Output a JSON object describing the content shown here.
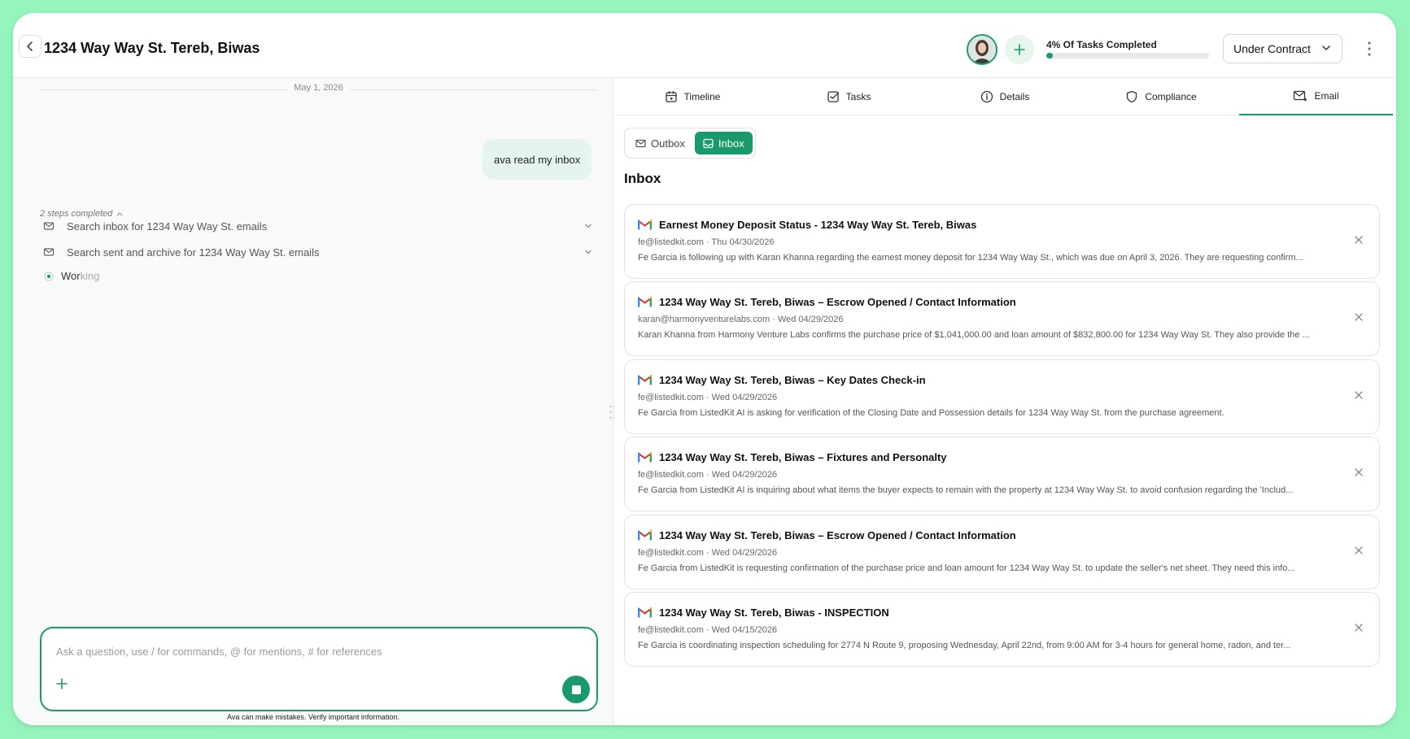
{
  "header": {
    "title": "1234 Way Way St. Tereb, Biwas",
    "progress_label": "4% Of Tasks Completed",
    "progress_fraction": 0.04,
    "status": "Under Contract"
  },
  "chat": {
    "date_separator": "May 1, 2026",
    "user_message": "ava read my inbox",
    "steps_summary": "2 steps completed",
    "steps": [
      {
        "label": "Search inbox for 1234 Way Way St. emails",
        "icon": "mail-icon"
      },
      {
        "label": "Search sent and archive for 1234 Way Way St. emails",
        "icon": "mail-icon"
      }
    ],
    "working_part1": "Wor",
    "working_part2": "king",
    "composer_placeholder": "Ask a question, use / for commands, @ for mentions, # for references",
    "disclaimer": "Ava can make mistakes. Verify important information."
  },
  "tabs": [
    {
      "label": "Timeline",
      "icon": "calendar-icon"
    },
    {
      "label": "Tasks",
      "icon": "checkbox-icon"
    },
    {
      "label": "Details",
      "icon": "info-icon"
    },
    {
      "label": "Compliance",
      "icon": "shield-icon"
    },
    {
      "label": "Email",
      "icon": "mail-icon",
      "active": true
    }
  ],
  "mailbox": {
    "outbox_label": "Outbox",
    "inbox_label": "Inbox",
    "heading": "Inbox"
  },
  "emails": [
    {
      "subject": "Earnest Money Deposit Status - 1234 Way Way St. Tereb, Biwas",
      "meta": "fe@listedkit.com · Thu 04/30/2026",
      "preview": "Fe Garcia is following up with Karan Khanna regarding the earnest money deposit for 1234 Way Way St., which was due on April 3, 2026. They are requesting confirm..."
    },
    {
      "subject": "1234 Way Way St. Tereb, Biwas – Escrow Opened / Contact Information",
      "meta": "karan@harmonyventurelabs.com · Wed 04/29/2026",
      "preview": "Karan Khanna from Harmony Venture Labs confirms the purchase price of $1,041,000.00 and loan amount of $832,800.00 for 1234 Way Way St. They also provide the ..."
    },
    {
      "subject": "1234 Way Way St. Tereb, Biwas – Key Dates Check-in",
      "meta": "fe@listedkit.com · Wed 04/29/2026",
      "preview": "Fe Garcia from ListedKit AI is asking for verification of the Closing Date and Possession details for 1234 Way Way St. from the purchase agreement."
    },
    {
      "subject": "1234 Way Way St. Tereb, Biwas – Fixtures and Personalty",
      "meta": "fe@listedkit.com · Wed 04/29/2026",
      "preview": "Fe Garcia from ListedKit AI is inquiring about what items the buyer expects to remain with the property at 1234 Way Way St. to avoid confusion regarding the 'Includ..."
    },
    {
      "subject": "1234 Way Way St. Tereb, Biwas – Escrow Opened / Contact Information",
      "meta": "fe@listedkit.com · Wed 04/29/2026",
      "preview": "Fe Garcia from ListedKit is requesting confirmation of the purchase price and loan amount for 1234 Way Way St. to update the seller's net sheet. They need this info..."
    },
    {
      "subject": "1234 Way Way St. Tereb, Biwas - INSPECTION",
      "meta": "fe@listedkit.com · Wed 04/15/2026",
      "preview": "Fe Garcia is coordinating inspection scheduling for 2774 N Route 9, proposing Wednesday, April 22nd, from 9:00 AM for 3-4 hours for general home, radon, and ter..."
    }
  ],
  "colors": {
    "accent": "#1a9a6b",
    "page_background": "#95f5bd",
    "bubble": "#e6f4ee"
  }
}
